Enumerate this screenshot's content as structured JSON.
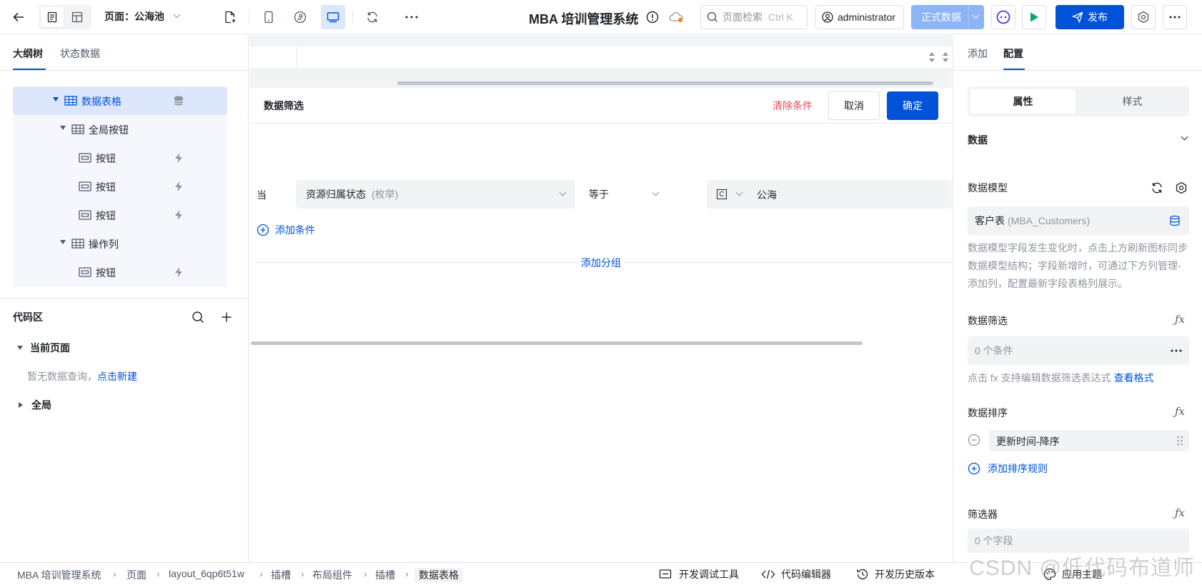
{
  "header": {
    "page_label": "页面：公海池",
    "title": "MBA 培训管理系统",
    "search_placeholder": "页面检索",
    "search_shortcut": "Ctrl K",
    "user": "administrator",
    "env": "正式数据",
    "publish": "发布"
  },
  "left": {
    "tabs": [
      "大纲树",
      "状态数据"
    ],
    "tree": [
      {
        "label": "数据表格"
      },
      {
        "label": "全局按钮"
      },
      {
        "label": "按钮"
      },
      {
        "label": "按钮"
      },
      {
        "label": "按钮"
      },
      {
        "label": "操作列"
      },
      {
        "label": "按钮"
      }
    ],
    "code_title": "代码区",
    "current_page": "当前页面",
    "empty_text": "暂无数据查询，",
    "create_new": "点击新建",
    "global": "全局"
  },
  "filter": {
    "title": "数据筛选",
    "clear": "清除条件",
    "cancel": "取消",
    "confirm": "确定",
    "when": "当",
    "field": "资源归属状态",
    "field_type": "(枚举)",
    "operator": "等于",
    "value_type": "C",
    "value": "公海",
    "add_condition": "添加条件",
    "add_group": "添加分组"
  },
  "right": {
    "tabs": [
      "添加",
      "配置"
    ],
    "seg": [
      "属性",
      "样式"
    ],
    "section": "数据",
    "model_label": "数据模型",
    "model_value": "客户表",
    "model_code": "(MBA_Customers)",
    "model_help": "数据模型字段发生变化时，点击上方刷新图标同步数据模型结构；字段新增时，可通过下方列管理-添加列，配置最新字段表格列展示。",
    "filter_label": "数据筛选",
    "filter_value": "0 个条件",
    "filter_help": "点击 fx 支持编辑数据筛选表达式",
    "filter_help_link": "查看格式",
    "sort_label": "数据排序",
    "sort_value": "更新时间-降序",
    "add_sort": "添加排序规则",
    "filterer_label": "筛选器",
    "filterer_value": "0 个字段"
  },
  "footer": {
    "crumbs": [
      "MBA 培训管理系统",
      "页面",
      "layout_6qp6t51w",
      "插槽",
      "布局组件",
      "插槽",
      "数据表格"
    ],
    "tools": [
      "开发调试工具",
      "代码编辑器",
      "开发历史版本",
      "应用主题"
    ]
  },
  "watermark": "CSDN @低代码布道师",
  "colors": {
    "primary": "#0052d9",
    "danger": "#e34d59",
    "env": "#8db4f5",
    "run": "#00a870"
  }
}
